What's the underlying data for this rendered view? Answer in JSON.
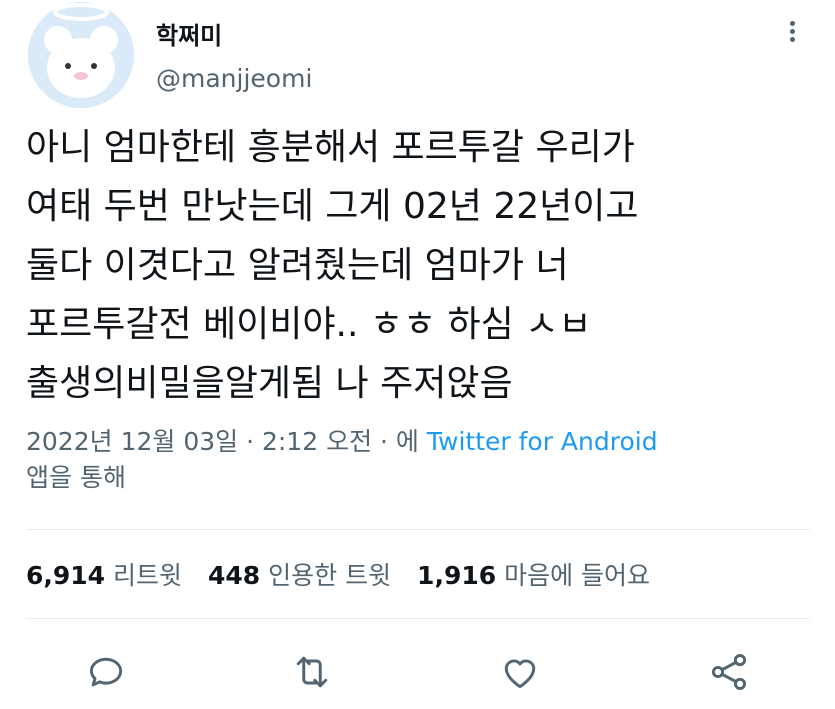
{
  "user": {
    "display_name": "학쩌미",
    "handle": "@manjjeomi"
  },
  "tweet": {
    "lines": [
      "아니 엄마한테 흥분해서 포르투갈 우리가",
      "여태 두번 만낫는데 그게 02년 22년이고",
      "둘다 이겻다고 알려줬는데 엄마가 너",
      "포르투갈전 베이비야.. ㅎㅎ 하심 ㅅㅂ",
      "출생의비밀을알게됨 나 주저앉음"
    ]
  },
  "meta": {
    "timestamp": "2022년 12월 03일 · 2:12 오전 · 에",
    "source": "Twitter for Android",
    "suffix": "앱을 통해"
  },
  "stats": {
    "retweets_count": "6,914",
    "retweets_label": "리트윗",
    "quotes_count": "448",
    "quotes_label": "인용한 트윗",
    "likes_count": "1,916",
    "likes_label": "마음에 들어요"
  },
  "icons": {
    "reply": "reply-icon",
    "retweet": "retweet-icon",
    "like": "heart-icon",
    "share": "share-icon",
    "more": "more-icon"
  },
  "colors": {
    "link": "#1d9bf0",
    "secondary_text": "#536471",
    "divider": "#e6ecf0"
  }
}
